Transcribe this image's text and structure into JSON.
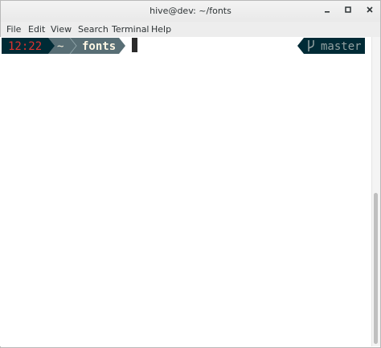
{
  "window": {
    "title": "hive@dev: ~/fonts",
    "controls": [
      "minimize-icon",
      "maximize-icon",
      "close-icon"
    ]
  },
  "menu": {
    "items": [
      "File",
      "Edit",
      "View",
      "Search",
      "Terminal",
      "Help"
    ]
  },
  "prompt": {
    "time": "12:22",
    "home": "~",
    "directory": "fonts",
    "branch_icon": "git-branch-icon",
    "branch": "master"
  },
  "colors": {
    "segment_dark": "#002b36",
    "segment_mid": "#586e75",
    "time_red": "#dc322f",
    "branch_fg": "#93a1a1"
  }
}
